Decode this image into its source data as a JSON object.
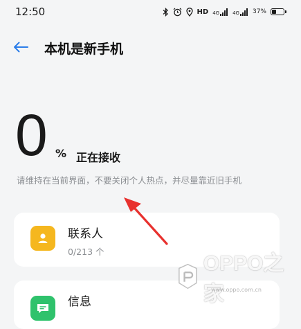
{
  "status_bar": {
    "time": "12:50",
    "hd_label": "HD",
    "network1": "4G",
    "network2": "4G",
    "battery": "37%"
  },
  "header": {
    "title": "本机是新手机"
  },
  "progress": {
    "value": "0",
    "unit": "%",
    "status": "正在接收"
  },
  "hint": "请维持在当前界面，不要关闭个人热点，并尽量靠近旧手机",
  "items": [
    {
      "title": "联系人",
      "count": "0/213 个",
      "icon": "contacts-icon",
      "color": "#f5b71f"
    },
    {
      "title": "信息",
      "icon": "message-icon",
      "color": "#2fc26c"
    }
  ],
  "watermark": {
    "text": "OPPO之家",
    "url": "www.oppo.com.cn"
  },
  "colors": {
    "back_arrow": "#2b7de9",
    "annotation": "#e8312e"
  }
}
